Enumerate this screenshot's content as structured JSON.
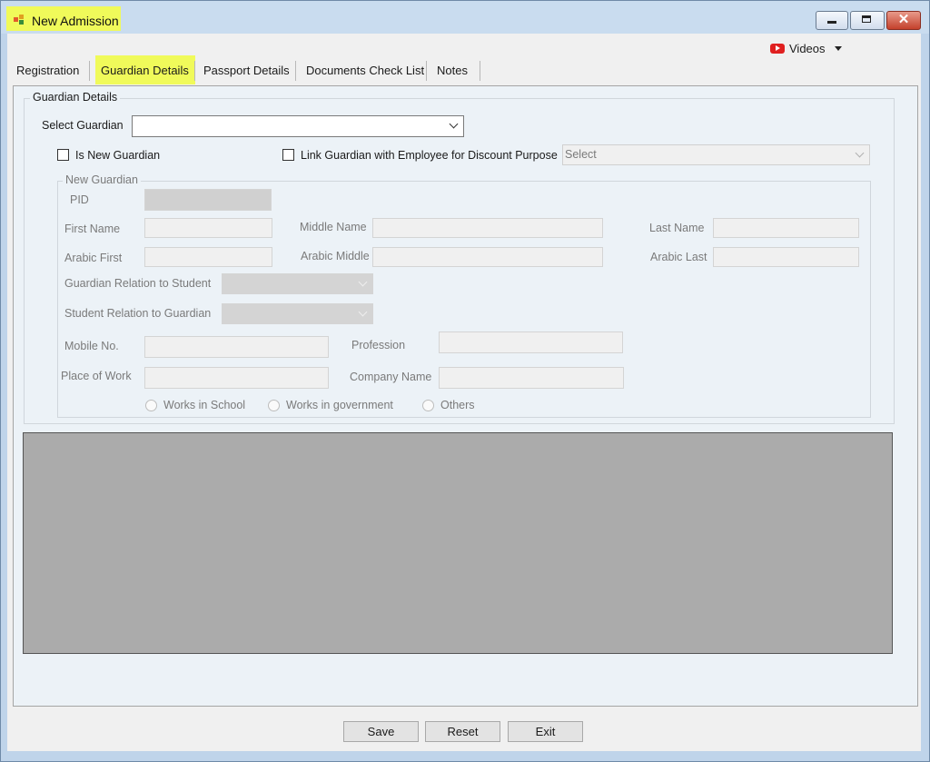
{
  "window": {
    "title": "New Admission"
  },
  "toolbar": {
    "videos_label": "Videos"
  },
  "tabs": [
    {
      "label": "Registration"
    },
    {
      "label": "Guardian Details"
    },
    {
      "label": "Passport Details"
    },
    {
      "label": "Documents Check List"
    },
    {
      "label": "Notes"
    }
  ],
  "guardian": {
    "group_title": "Guardian Details",
    "select_guardian_label": "Select Guardian",
    "select_guardian_value": "",
    "is_new_guardian_label": "Is New Guardian",
    "link_employee_label": "Link Guardian with Employee for Discount Purpose",
    "employee_select_placeholder": "Select"
  },
  "new_guardian": {
    "group_title": "New Guardian",
    "pid_label": "PID",
    "first_name_label": "First Name",
    "middle_name_label": "Middle Name",
    "last_name_label": "Last Name",
    "arabic_first_label": "Arabic First",
    "arabic_middle_label": "Arabic Middle",
    "arabic_last_label": "Arabic Last",
    "relation_to_student_label": "Guardian Relation to Student",
    "student_relation_label": "Student Relation to Guardian",
    "mobile_label": "Mobile No.",
    "profession_label": "Profession",
    "place_of_work_label": "Place of Work",
    "company_name_label": "Company Name",
    "work_options": [
      "Works in School",
      "Works in government",
      "Others"
    ]
  },
  "buttons": {
    "save": "Save",
    "reset": "Reset",
    "exit": "Exit"
  }
}
